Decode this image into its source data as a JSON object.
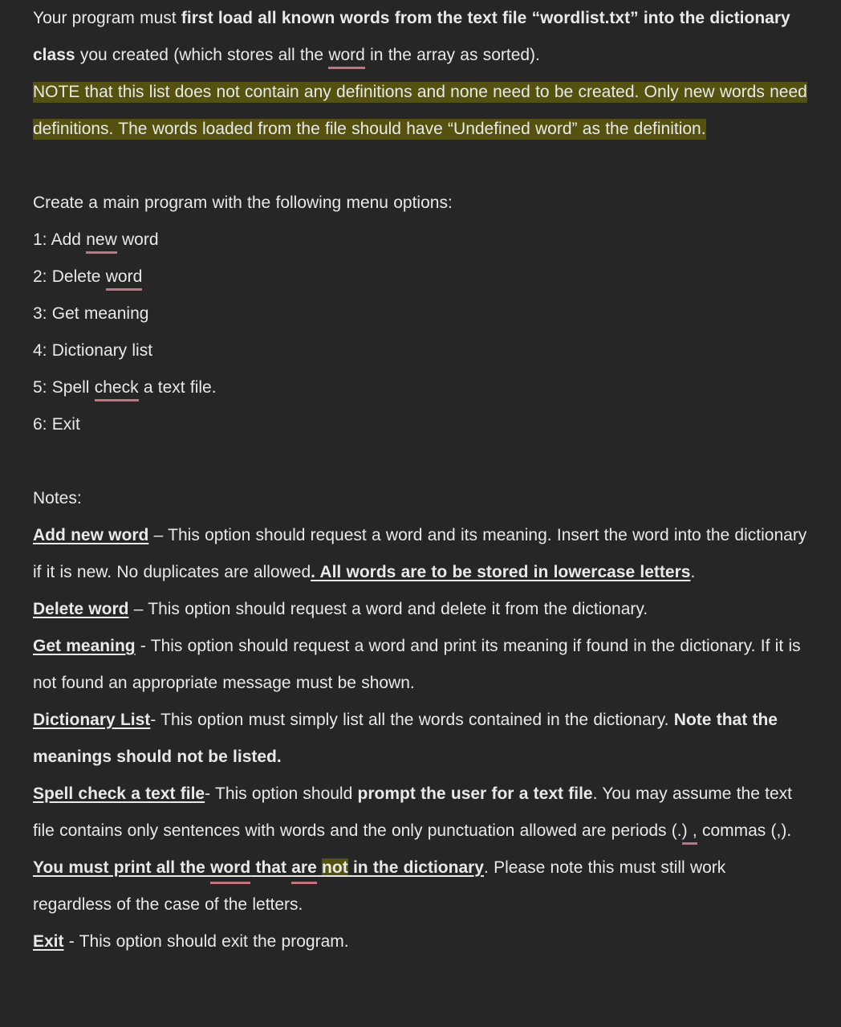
{
  "document": {
    "theme": {
      "background": "#262626",
      "text_color": "#e9e9e9",
      "highlight_color": "#55520f",
      "spellcheck_underline_color": "#c4737f"
    },
    "intro": {
      "p1_run1": " Your program must ",
      "p1_run2_bold": "first load all known words from the text file “wordlist.txt” into the dictionary class",
      "p1_run3": " you created (which stores all the ",
      "p1_run4_spellcheck": "word",
      "p1_run5": " in the array as sorted).",
      "p2_highlighted": "NOTE that this list does not contain any definitions and none need to be created. Only new words need definitions. The words loaded from the file should have “Undefined word” as the definition."
    },
    "menu": {
      "lead_in": "Create a main program with the following menu options:",
      "options": [
        {
          "prefix": "1: Add ",
          "spellcheck": "new",
          "suffix": " word"
        },
        {
          "prefix": "2: Delete ",
          "spellcheck": "word",
          "suffix": ""
        },
        {
          "prefix": "3: Get meaning",
          "spellcheck": "",
          "suffix": ""
        },
        {
          "prefix": "4: Dictionary list",
          "spellcheck": "",
          "suffix": ""
        },
        {
          "prefix": "5: Spell ",
          "spellcheck": "check",
          "suffix": " a text file."
        },
        {
          "prefix": "6: Exit",
          "spellcheck": "",
          "suffix": ""
        }
      ]
    },
    "notes": {
      "heading": "Notes:",
      "add_new_word": {
        "term": "Add new word",
        "body_1": " – This option should request a word and its meaning. Insert the word into the dictionary if it is new. No duplicates are allowed",
        "emphasis": ". All words are to be stored in lowercase letters",
        "body_2": "."
      },
      "delete_word": {
        "term": "Delete word",
        "body": " – This option should request a word and delete it from the dictionary."
      },
      "get_meaning": {
        "term": "Get meaning",
        "body": " - This option should request a word and print its meaning if found in the dictionary. If it is not found an appropriate message must be shown."
      },
      "dictionary_list": {
        "term": "Dictionary List",
        "body_1": "- This option must simply list all the words contained in the dictionary. ",
        "emphasis": "Note that the meanings should not be listed."
      },
      "spell_check": {
        "term": "Spell check a text file",
        "body_1": "- This option should ",
        "bold_1": "prompt the user for a text file",
        "body_2": ". You may assume the text file contains only sentences with words and the only punctuation allowed are periods (.",
        "spell_1": ") ,",
        "body_3": " commas (,). ",
        "emph_1": "You must print all the ",
        "emph_spell_1": "word",
        "emph_2": " that ",
        "emph_spell_2": "are",
        "emph_3": " ",
        "emph_highlight": "not",
        "emph_4": " in the dictionary",
        "body_4": ". Please note this must still work regardless of the case of the letters."
      },
      "exit": {
        "term": "Exit",
        "body": " - This option should exit the program."
      }
    }
  }
}
